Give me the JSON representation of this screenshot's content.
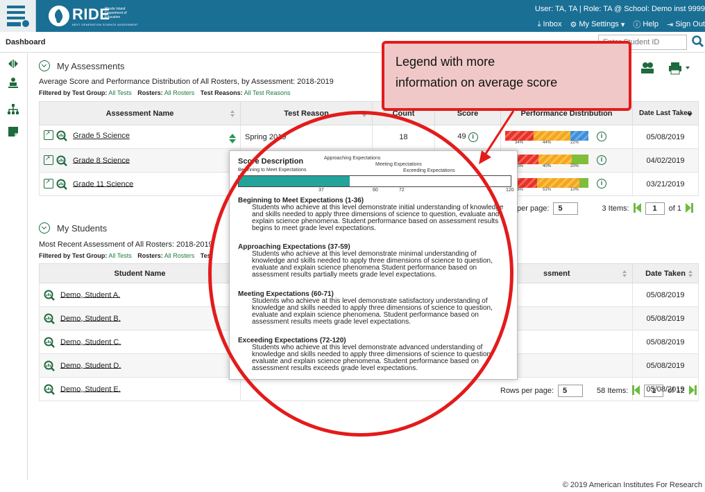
{
  "header": {
    "logo_text": "RIDE",
    "logo_sub": "Rhode Island Department of Education",
    "logo_tag": "NEXT GENERATION SCIENCE ASSESSMENT",
    "user_info": "User: TA, TA  |  Role: TA @ School: Demo inst 9999",
    "links": {
      "inbox": "Inbox",
      "settings": "My Settings",
      "help": "Help",
      "signout": "Sign Out"
    }
  },
  "titlebar": {
    "title": "Dashboard",
    "student_placeholder": "Enter Student ID"
  },
  "assessments": {
    "title": "My Assessments",
    "description": "Average Score and Performance Distribution of All Rosters, by Assessment: 2018-2019",
    "filter": {
      "group_label": "Filtered by Test Group:",
      "group_value": "All Tests",
      "rosters_label": "Rosters:",
      "rosters_value": "All Rosters",
      "reasons_label": "Test Reasons:",
      "reasons_value": "All Test Reasons"
    },
    "columns": {
      "name": "Assessment Name",
      "reason": "Test Reason",
      "count": "Count",
      "score": "Score",
      "perf": "Performance Distribution",
      "date": "Date Last Taken"
    },
    "rows": [
      {
        "name": "Grade 5 Science",
        "reason": "Spring 2019",
        "count": "18",
        "score": "49",
        "pcts": [
          "34%",
          "44%",
          "22%"
        ],
        "date": "05/08/2019"
      },
      {
        "name": "Grade 8 Science",
        "pcts": [
          "40%",
          "40%",
          "20%"
        ],
        "date": "04/02/2019"
      },
      {
        "name": "Grade 11 Science",
        "pcts": [
          "38%",
          "51%",
          "10%"
        ],
        "date": "03/21/2019"
      }
    ],
    "pager": {
      "rows_label": "per page:",
      "rows_value": "5",
      "items": "3 Items:",
      "page": "1",
      "of": "of 1"
    }
  },
  "students": {
    "title": "My Students",
    "description": "Most Recent Assessment of All Rosters: 2018-2019",
    "filter": {
      "group_label": "Filtered by Test Group:",
      "group_value": "All Tests",
      "rosters_label": "Rosters:",
      "rosters_value": "All Rosters",
      "reasons_label": "Test"
    },
    "columns": {
      "name": "Student Name",
      "assessment": "ssment",
      "date": "Date Taken"
    },
    "rows": [
      {
        "name": "Demo, Student A.",
        "date": "05/08/2019"
      },
      {
        "name": "Demo, Student B.",
        "date": "05/08/2019"
      },
      {
        "name": "Demo, Student C.",
        "date": "05/08/2019"
      },
      {
        "name": "Demo, Student D.",
        "date": "05/08/2019"
      },
      {
        "name": "Demo, Student E.",
        "date": "05/08/2019"
      }
    ],
    "pager": {
      "rows_label": "Rows per page:",
      "rows_value": "5",
      "items": "58 Items:",
      "page": "1",
      "of": "of 12"
    }
  },
  "popup": {
    "title": "Score Description",
    "labels": {
      "begin": "Beginning to Meet Expectations",
      "approach": "Approaching Expectations",
      "meeting": "Meeting Expectations",
      "exceed": "Exceeding Expectations"
    },
    "ticks": [
      "37",
      "60",
      "72",
      "120"
    ],
    "levels": [
      {
        "head": "Beginning to Meet Expectations (1-36)",
        "text": "Students who achieve at this level demonstrate initial understanding of knowledge and skills needed to apply three dimensions of science to question, evaluate and explain science phenomena. Student performance based on assessment results begins to meet grade level expectations."
      },
      {
        "head": "Approaching Expectations (37-59)",
        "text": "Students who achieve at this level demonstrate minimal understanding of knowledge and skills needed to apply three dimensions of science to question, evaluate and explain science phenomena Student performance based on assessment results partially meets grade level expectations."
      },
      {
        "head": "Meeting Expectations (60-71)",
        "text": "Students who achieve at this level demonstrate satisfactory understanding of knowledge and skills needed to apply three dimensions of science to question, evaluate and explain science phenomena. Student performance based on assessment results meets grade level expectations."
      },
      {
        "head": "Exceeding Expectations (72-120)",
        "text": "Students who achieve at this level demonstrate advanced understanding of knowledge and skills needed to apply three dimensions of science to question, evaluate and explain science phenomena. Student performance based on assessment results exceeds grade level expectations."
      }
    ]
  },
  "callout": {
    "line1": "Legend with more",
    "line2": "information on average score"
  },
  "footer": "© 2019 American Institutes For Research",
  "colors": {
    "header": "#1a6f95",
    "accent_green": "#1f6a3e",
    "annotation_red": "#e31b1b"
  }
}
